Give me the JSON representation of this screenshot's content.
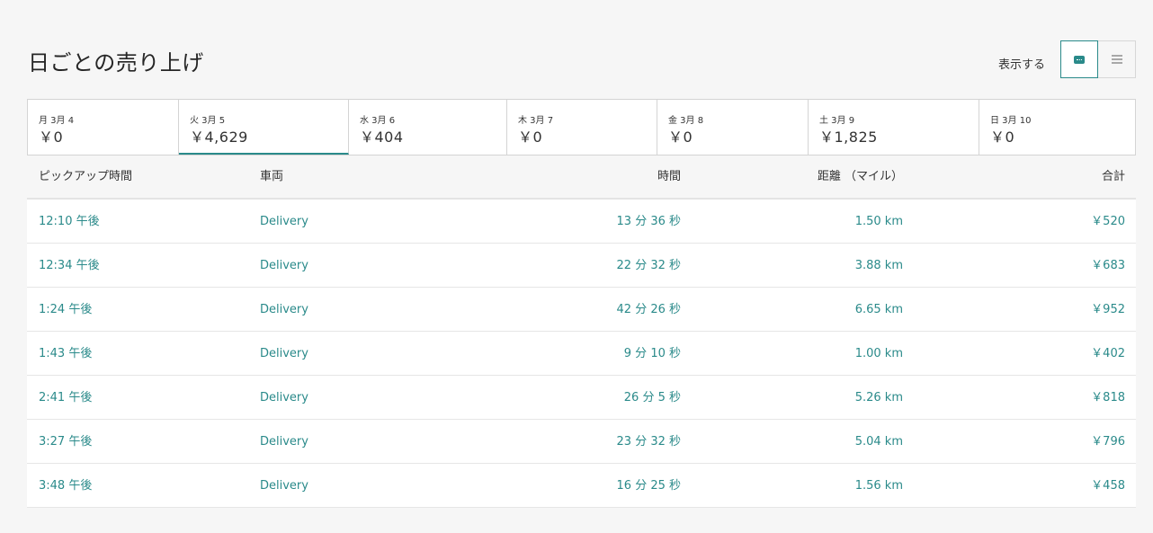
{
  "header": {
    "title": "日ごとの売り上げ",
    "view_label": "表示する",
    "accent_color": "#2a8a8a"
  },
  "view_toggle": {
    "active_icon": "card-view-icon",
    "inactive_icon": "list-view-icon"
  },
  "days": [
    {
      "label": "月 3月 4",
      "amount": "￥0",
      "selected": false
    },
    {
      "label": "火 3月 5",
      "amount": "￥4,629",
      "selected": true
    },
    {
      "label": "水 3月 6",
      "amount": "￥404",
      "selected": false
    },
    {
      "label": "木 3月 7",
      "amount": "￥0",
      "selected": false
    },
    {
      "label": "金 3月 8",
      "amount": "￥0",
      "selected": false
    },
    {
      "label": "土 3月 9",
      "amount": "￥1,825",
      "selected": false
    },
    {
      "label": "日 3月 10",
      "amount": "￥0",
      "selected": false
    }
  ],
  "table": {
    "columns": [
      "ピックアップ時間",
      "車両",
      "時間",
      "距離 （マイル）",
      "合計"
    ],
    "rows": [
      [
        "12:10 午後",
        "Delivery",
        "13 分 36 秒",
        "1.50 km",
        "￥520"
      ],
      [
        "12:34 午後",
        "Delivery",
        "22 分 32 秒",
        "3.88 km",
        "￥683"
      ],
      [
        "1:24 午後",
        "Delivery",
        "42 分 26 秒",
        "6.65 km",
        "￥952"
      ],
      [
        "1:43 午後",
        "Delivery",
        "9 分 10 秒",
        "1.00 km",
        "￥402"
      ],
      [
        "2:41 午後",
        "Delivery",
        "26 分 5 秒",
        "5.26 km",
        "￥818"
      ],
      [
        "3:27 午後",
        "Delivery",
        "23 分 32 秒",
        "5.04 km",
        "￥796"
      ],
      [
        "3:48 午後",
        "Delivery",
        "16 分 25 秒",
        "1.56 km",
        "￥458"
      ]
    ]
  }
}
